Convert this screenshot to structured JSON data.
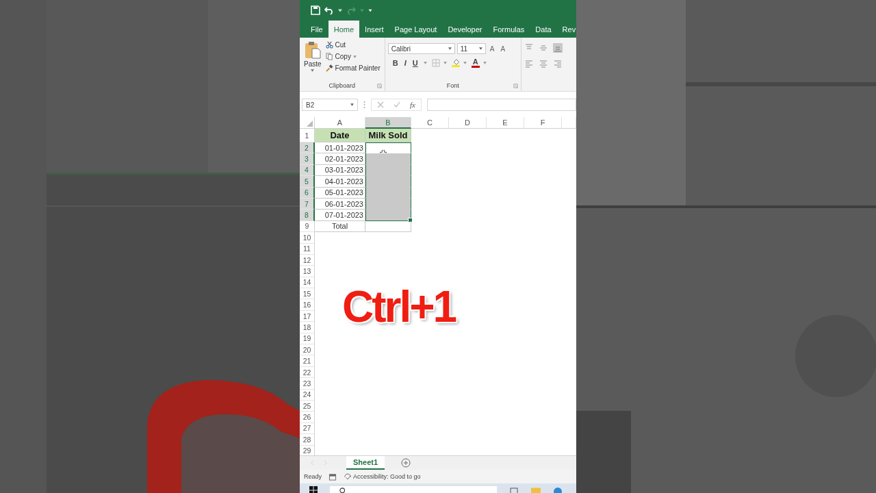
{
  "ribbon_tabs": [
    {
      "label": "File",
      "selected": false
    },
    {
      "label": "Home",
      "selected": true
    },
    {
      "label": "Insert",
      "selected": false
    },
    {
      "label": "Page Layout",
      "selected": false
    },
    {
      "label": "Developer",
      "selected": false
    },
    {
      "label": "Formulas",
      "selected": false
    },
    {
      "label": "Data",
      "selected": false
    },
    {
      "label": "Rev",
      "selected": false
    }
  ],
  "clipboard": {
    "paste": "Paste",
    "buttons": [
      {
        "label": "Cut",
        "kind": "cut"
      },
      {
        "label": "Copy",
        "kind": "copy"
      },
      {
        "label": "Format Painter",
        "kind": "painter"
      }
    ],
    "label": "Clipboard"
  },
  "font": {
    "name": "Calibri",
    "size": "11",
    "grow": "A",
    "shrink": "A",
    "styles": [
      "B",
      "I",
      "U"
    ],
    "color_letter": "A",
    "label": "Font"
  },
  "formula_bar": {
    "name_box": "B2",
    "function_label": "fx"
  },
  "columns": [
    {
      "label": "A",
      "selected": false
    },
    {
      "label": "B",
      "selected": true
    },
    {
      "label": "C",
      "selected": false
    },
    {
      "label": "D",
      "selected": false
    },
    {
      "label": "E",
      "selected": false
    },
    {
      "label": "F",
      "selected": false
    }
  ],
  "rows": [
    {
      "num": "1",
      "selected": false,
      "cells": [
        {
          "text": "Date",
          "kind": "header"
        },
        {
          "text": "Milk Sold",
          "kind": "header"
        }
      ]
    },
    {
      "num": "2",
      "selected": true,
      "cells": [
        {
          "text": "01-01-2023",
          "kind": "date"
        },
        {
          "kind": "active"
        }
      ]
    },
    {
      "num": "3",
      "selected": true,
      "cells": [
        {
          "text": "02-01-2023",
          "kind": "date"
        },
        {
          "kind": "selected"
        }
      ]
    },
    {
      "num": "4",
      "selected": true,
      "cells": [
        {
          "text": "03-01-2023",
          "kind": "date"
        },
        {
          "kind": "selected"
        }
      ]
    },
    {
      "num": "5",
      "selected": true,
      "cells": [
        {
          "text": "04-01-2023",
          "kind": "date"
        },
        {
          "kind": "selected"
        }
      ]
    },
    {
      "num": "6",
      "selected": true,
      "cells": [
        {
          "text": "05-01-2023",
          "kind": "date"
        },
        {
          "kind": "selected"
        }
      ]
    },
    {
      "num": "7",
      "selected": true,
      "cells": [
        {
          "text": "06-01-2023",
          "kind": "date"
        },
        {
          "kind": "selected"
        }
      ]
    },
    {
      "num": "8",
      "selected": true,
      "cells": [
        {
          "text": "07-01-2023",
          "kind": "date"
        },
        {
          "kind": "selected"
        }
      ]
    },
    {
      "num": "9",
      "selected": false,
      "cells": [
        {
          "text": "Total",
          "kind": "label"
        },
        {
          "kind": "plain"
        }
      ]
    },
    {
      "num": "10",
      "selected": false
    },
    {
      "num": "11",
      "selected": false
    },
    {
      "num": "12",
      "selected": false
    },
    {
      "num": "13",
      "selected": false
    },
    {
      "num": "14",
      "selected": false
    },
    {
      "num": "15",
      "selected": false
    },
    {
      "num": "16",
      "selected": false
    },
    {
      "num": "17",
      "selected": false
    },
    {
      "num": "18",
      "selected": false
    },
    {
      "num": "19",
      "selected": false
    },
    {
      "num": "20",
      "selected": false
    },
    {
      "num": "21",
      "selected": false
    },
    {
      "num": "22",
      "selected": false
    },
    {
      "num": "23",
      "selected": false
    },
    {
      "num": "24",
      "selected": false
    },
    {
      "num": "25",
      "selected": false
    },
    {
      "num": "26",
      "selected": false
    },
    {
      "num": "27",
      "selected": false
    },
    {
      "num": "28",
      "selected": false
    },
    {
      "num": "29",
      "selected": false
    }
  ],
  "caption": "Ctrl+1",
  "sheets": [
    {
      "label": "Sheet1",
      "selected": true
    }
  ],
  "status_bar": {
    "mode": "Ready",
    "accessibility": "Accessibility: Good to go"
  }
}
